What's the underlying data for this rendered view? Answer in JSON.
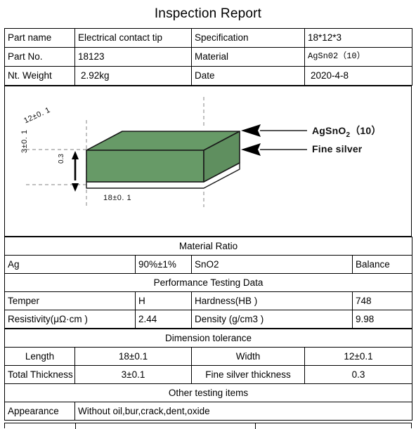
{
  "report": {
    "title": "Inspection Report"
  },
  "header_table": {
    "rows": [
      {
        "label": "Part name",
        "value": "Electrical contact tip",
        "label2": "Specification",
        "value2": "18*12*3"
      },
      {
        "label": "Part No.",
        "value": "18123",
        "label2": "Material",
        "value2": "AgSn02（10）"
      },
      {
        "label": "Nt. Weight",
        "value": "2.92kg",
        "label2": "Date",
        "value2": "2020-4-8"
      }
    ]
  },
  "diagram": {
    "labels": {
      "width_dim": "12±0. 1",
      "length_dim": "18±0. 1",
      "thickness_dim": "3±0. 1",
      "silver_dim": "0.3",
      "callout_top": "AgSnO",
      "callout_top_sub": "2",
      "callout_top_tail": "（10）",
      "callout_bottom": "Fine silver"
    },
    "colors": {
      "body_green": "#679a67",
      "body_green_side": "#5f8f5f",
      "silver_layer": "#ffffff",
      "outline": "#1a1a1a",
      "dashed": "#9a9a9a",
      "leader": "#555555"
    }
  },
  "material_ratio": {
    "section_title": "Material Ratio",
    "row": {
      "name1": "Ag",
      "value1": "90%±1%",
      "name2": "SnO2",
      "value2": "Balance"
    }
  },
  "performance": {
    "section_title": "Performance Testing Data",
    "rows": [
      {
        "label": "Temper",
        "value": "H",
        "label2": "Hardness(HB )",
        "value2": "748"
      },
      {
        "label": "Resistivity(μΩ·cm )",
        "value": "2.44",
        "label2": "Density (g/cm3 )",
        "value2": "9.98"
      }
    ]
  },
  "dimension_tolerance": {
    "section_title": "Dimension tolerance",
    "rows": [
      {
        "label": "Length",
        "value": "18±0.1",
        "label2": "Width",
        "value2": "12±0.1"
      },
      {
        "label": "Total Thickness",
        "value": "3±0.1",
        "label2": "Fine silver thickness",
        "value2": "0.3"
      }
    ]
  },
  "other_testing": {
    "section_title": "Other testing items",
    "rows": [
      {
        "label": "Appearance",
        "value": "Without oil,bur,crack,dent,oxide"
      }
    ]
  }
}
